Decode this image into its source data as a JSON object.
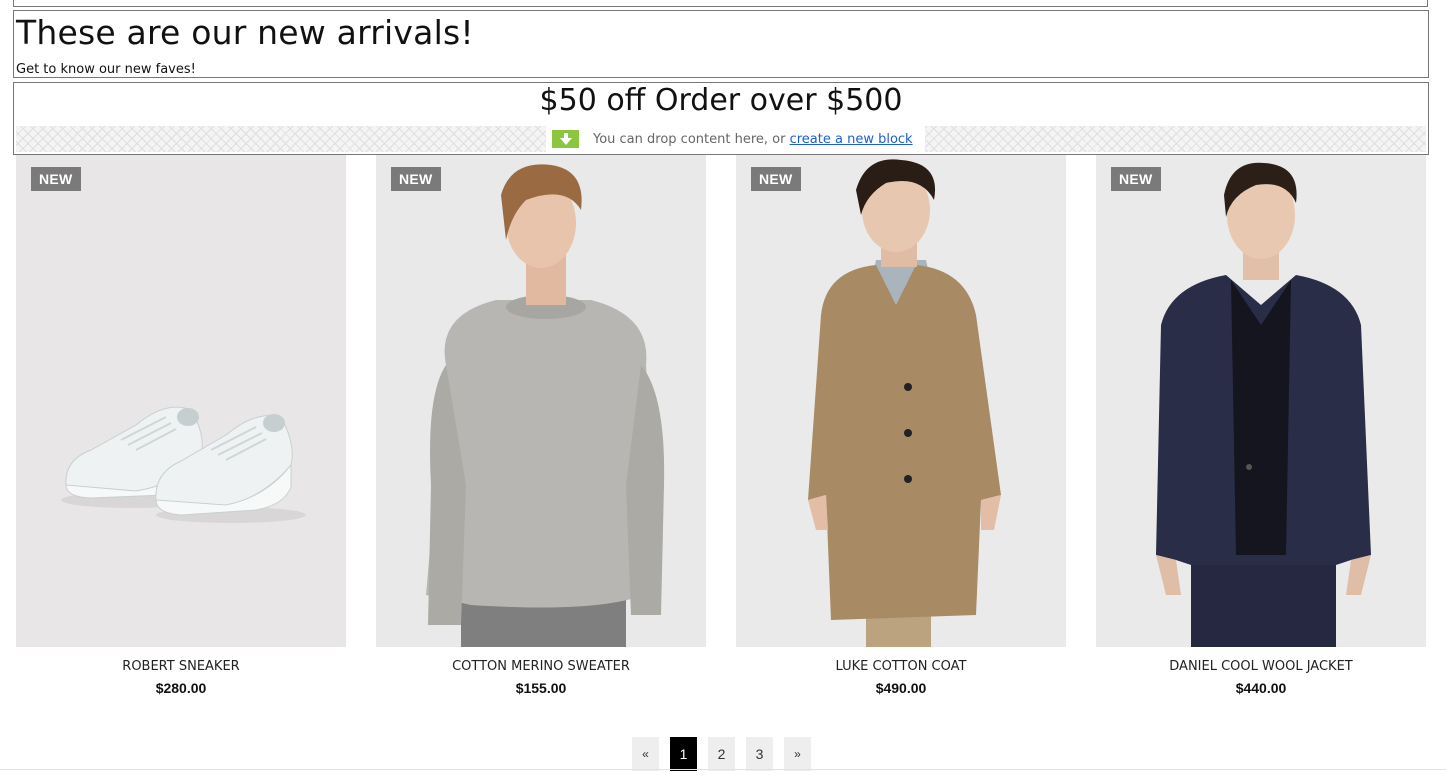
{
  "heading": {
    "title": "These are our new arrivals!",
    "subtitle": "Get to know our new faves!"
  },
  "promo": {
    "title": "$50 off Order over $500"
  },
  "drop_zone": {
    "text": "You can drop content here, or",
    "link": "create a new block",
    "icon": "arrow-down-icon",
    "icon_color": "#8cc63f"
  },
  "products": [
    {
      "badge": "NEW",
      "name": "ROBERT SNEAKER",
      "price": "$280.00",
      "image": "white-sneakers"
    },
    {
      "badge": "NEW",
      "name": "COTTON MERINO SWEATER",
      "price": "$155.00",
      "image": "grey-sweater-model"
    },
    {
      "badge": "NEW",
      "name": "LUKE COTTON COAT",
      "price": "$490.00",
      "image": "camel-coat-model"
    },
    {
      "badge": "NEW",
      "name": "DANIEL COOL WOOL JACKET",
      "price": "$440.00",
      "image": "navy-jacket-model"
    }
  ],
  "pagination": {
    "prev": "«",
    "pages": [
      "1",
      "2",
      "3"
    ],
    "next": "»",
    "current": "1"
  }
}
